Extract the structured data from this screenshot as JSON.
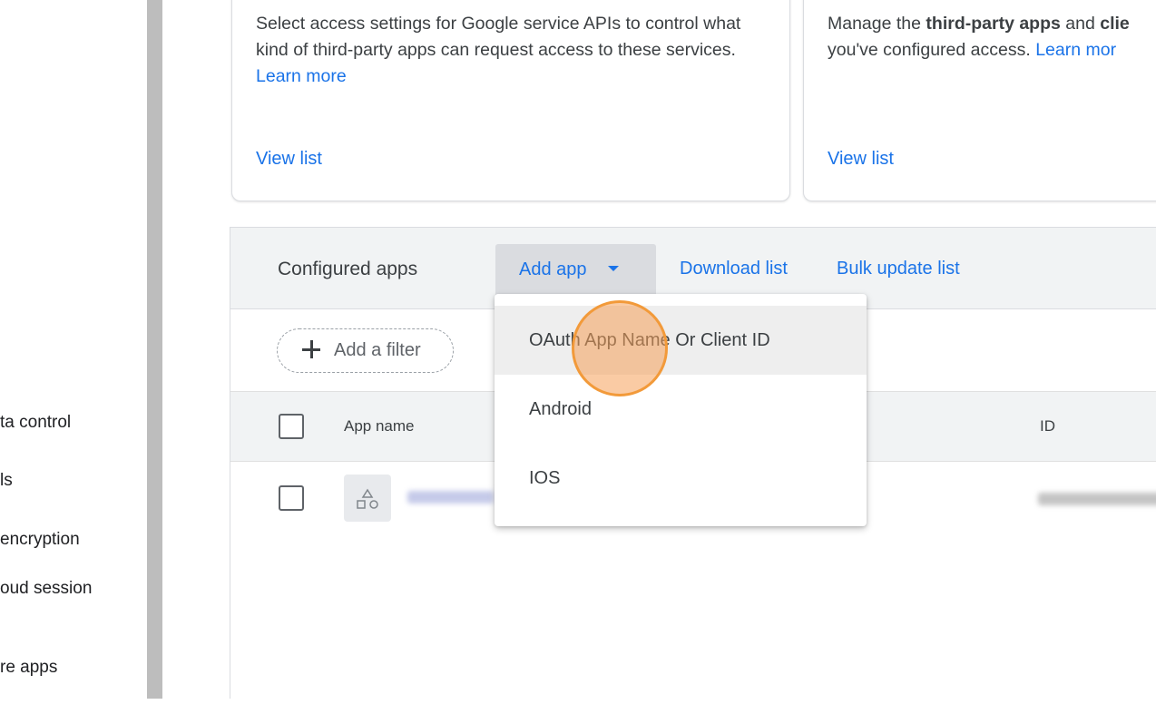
{
  "sidebar": {
    "items": [
      {
        "label": "ta control"
      },
      {
        "label": "ls"
      },
      {
        "label": " encryption"
      },
      {
        "label": "oud session"
      },
      {
        "label": "re apps"
      }
    ]
  },
  "cards": {
    "api_access": {
      "text": "Select access settings for Google service APIs to control what kind of third-party apps can request access to these services.",
      "learn_more": "Learn more",
      "view_list": "View list"
    },
    "app_access": {
      "line1_prefix": "Manage the ",
      "line1_bold1": "third-party apps",
      "line1_mid": " and ",
      "line1_bold2": "clie",
      "line2": "you've configured access.",
      "learn_more": "Learn mor",
      "view_list": "View list"
    }
  },
  "configured_apps": {
    "title": "Configured apps",
    "add_app": "Add app",
    "download_list": "Download list",
    "bulk_update_list": "Bulk update list",
    "add_filter": "Add a filter",
    "columns": {
      "app_name": "App name",
      "id": "ID"
    },
    "row_icon_label": "app-placeholder-icon"
  },
  "dropdown": {
    "items": [
      {
        "label": "OAuth App Name Or Client ID",
        "highlighted": true
      },
      {
        "label": "Android",
        "highlighted": false
      },
      {
        "label": "IOS",
        "highlighted": false
      }
    ]
  },
  "colors": {
    "link": "#1a73e8",
    "header_bg": "#f1f3f4",
    "cursor_highlight": "#f29a3a"
  }
}
